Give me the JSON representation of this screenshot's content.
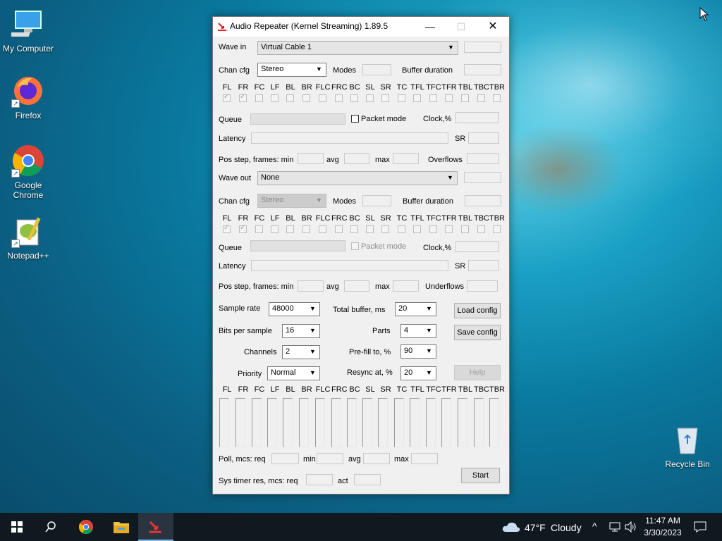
{
  "desktop": {
    "icons": [
      {
        "label": "My Computer"
      },
      {
        "label": "Firefox"
      },
      {
        "label": "Google Chrome"
      },
      {
        "label": "Notepad++"
      },
      {
        "label": "Recycle Bin"
      }
    ]
  },
  "window": {
    "title": "Audio Repeater (Kernel Streaming) 1.89.5",
    "wave_in": {
      "label": "Wave in",
      "device": "Virtual Cable 1",
      "chan_cfg_label": "Chan cfg",
      "chan_cfg": "Stereo",
      "modes_label": "Modes",
      "buffer_duration_label": "Buffer duration",
      "channels": [
        "FL",
        "FR",
        "FC",
        "LF",
        "BL",
        "BR",
        "FLC",
        "FRC",
        "BC",
        "SL",
        "SR",
        "TC",
        "TFL",
        "TFC",
        "TFR",
        "TBL",
        "TBC",
        "TBR"
      ],
      "queue_label": "Queue",
      "packet_mode_label": "Packet mode",
      "clock_label": "Clock,%",
      "latency_label": "Latency",
      "sr_label": "SR",
      "pos_step_label": "Pos step, frames:  min",
      "avg_label": "avg",
      "max_label": "max",
      "overflows_label": "Overflows"
    },
    "wave_out": {
      "label": "Wave out",
      "device": "None",
      "chan_cfg_label": "Chan cfg",
      "chan_cfg": "Stereo",
      "modes_label": "Modes",
      "buffer_duration_label": "Buffer duration",
      "channels": [
        "FL",
        "FR",
        "FC",
        "LF",
        "BL",
        "BR",
        "FLC",
        "FRC",
        "BC",
        "SL",
        "SR",
        "TC",
        "TFL",
        "TFC",
        "TFR",
        "TBL",
        "TBC",
        "TBR"
      ],
      "queue_label": "Queue",
      "packet_mode_label": "Packet mode",
      "clock_label": "Clock,%",
      "latency_label": "Latency",
      "sr_label": "SR",
      "pos_step_label": "Pos step, frames:  min",
      "avg_label": "avg",
      "max_label": "max",
      "underflows_label": "Underflows"
    },
    "settings": {
      "sample_rate_label": "Sample rate",
      "sample_rate": "48000",
      "total_buffer_label": "Total buffer, ms",
      "total_buffer": "20",
      "bits_label": "Bits per sample",
      "bits": "16",
      "parts_label": "Parts",
      "parts": "4",
      "channels_label": "Channels",
      "channels": "2",
      "prefill_label": "Pre-fill to, %",
      "prefill": "90",
      "priority_label": "Priority",
      "priority": "Normal",
      "resync_label": "Resync at, %",
      "resync": "20"
    },
    "buttons": {
      "load_config": "Load config",
      "save_config": "Save config",
      "help": "Help",
      "start": "Start"
    },
    "meters": {
      "channels": [
        "FL",
        "FR",
        "FC",
        "LF",
        "BL",
        "BR",
        "FLC",
        "FRC",
        "BC",
        "SL",
        "SR",
        "TC",
        "TFL",
        "TFC",
        "TFR",
        "TBL",
        "TBC",
        "TBR"
      ]
    },
    "poll": {
      "label": "Poll, mcs:  req",
      "min_label": "min",
      "avg_label": "avg",
      "max_label": "max"
    },
    "sys_timer": {
      "label": "Sys timer res, mcs:  req",
      "act_label": "act"
    }
  },
  "taskbar": {
    "weather_temp": "47°F",
    "weather_text": "Cloudy",
    "time": "11:47 AM",
    "date": "3/30/2023"
  }
}
